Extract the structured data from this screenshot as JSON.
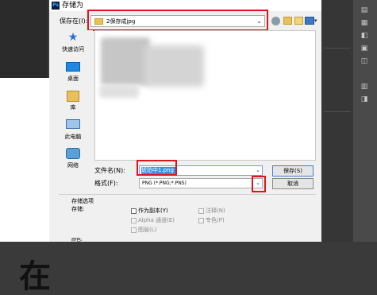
{
  "dialog": {
    "title": "存储为",
    "ps_badge": "Ps"
  },
  "location": {
    "label": "保存在(I):",
    "value": "2保存成jpg"
  },
  "places": [
    {
      "label": "快速访问",
      "icon": "quick-access-icon"
    },
    {
      "label": "桌面",
      "icon": "desktop-icon"
    },
    {
      "label": "库",
      "icon": "library-icon"
    },
    {
      "label": "此电脑",
      "icon": "computer-icon"
    },
    {
      "label": "网络",
      "icon": "network-icon"
    }
  ],
  "filename": {
    "label": "文件名(N):",
    "value": "琥珀中1.png"
  },
  "format": {
    "label": "格式(F):",
    "value": "PNG (*.PNG;*.PNS)"
  },
  "buttons": {
    "save": "保存(S)",
    "cancel": "取消"
  },
  "save_options": {
    "header": "存储选项",
    "store_label": "存储:",
    "checkboxes": [
      {
        "label": "作为副本(Y)",
        "enabled": true
      },
      {
        "label": "注释(N)",
        "enabled": false
      },
      {
        "label": "Alpha 通道(E)",
        "enabled": false
      },
      {
        "label": "专色(P)",
        "enabled": false
      },
      {
        "label": "图层(L)",
        "enabled": false
      }
    ],
    "cut_label": "颜色:"
  },
  "background": {
    "big_char": "在"
  },
  "colors": {
    "highlight_red": "#e0141e",
    "selection_blue": "#3a8ee6"
  }
}
